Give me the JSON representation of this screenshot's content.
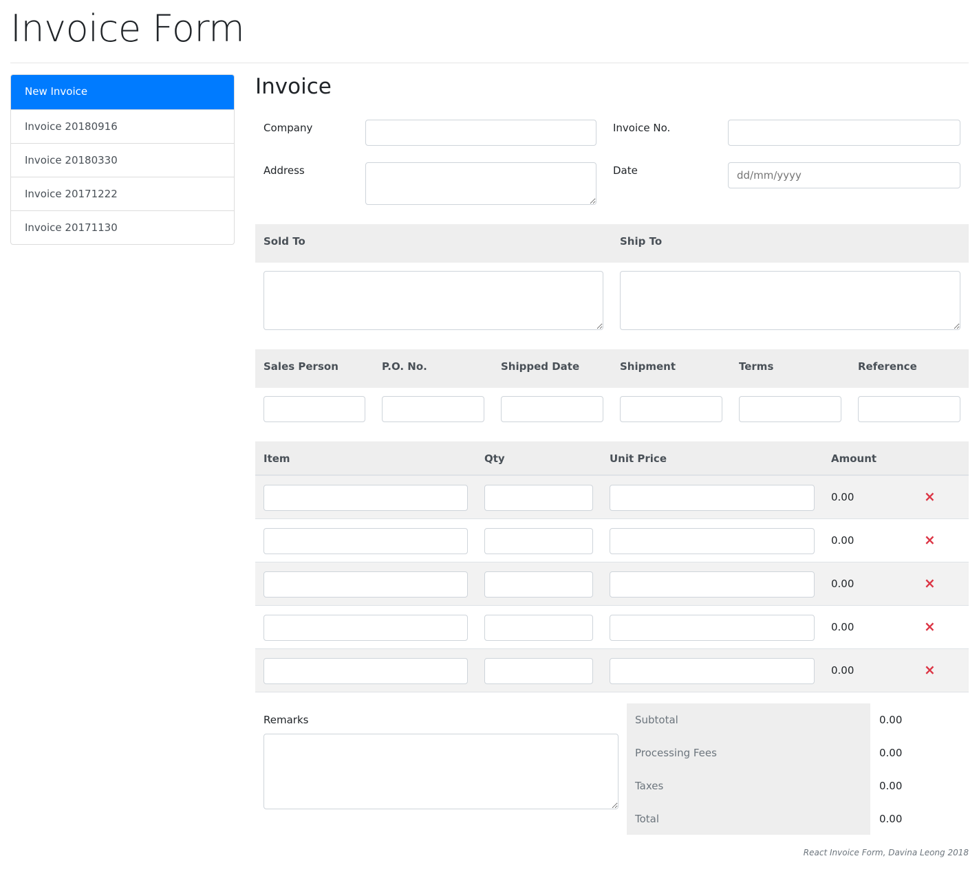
{
  "title": "Invoice Form",
  "sidebar": {
    "items": [
      {
        "label": "New Invoice"
      },
      {
        "label": "Invoice 20180916"
      },
      {
        "label": "Invoice 20180330"
      },
      {
        "label": "Invoice 20171222"
      },
      {
        "label": "Invoice 20171130"
      }
    ]
  },
  "form": {
    "heading": "Invoice",
    "company_label": "Company",
    "invoice_no_label": "Invoice No.",
    "address_label": "Address",
    "date_label": "Date",
    "date_placeholder": "dd/mm/yyyy"
  },
  "addresses": {
    "sold_to": "Sold To",
    "ship_to": "Ship To"
  },
  "details": {
    "headers": [
      "Sales Person",
      "P.O. No.",
      "Shipped Date",
      "Shipment",
      "Terms",
      "Reference"
    ]
  },
  "items": {
    "headers": {
      "item": "Item",
      "qty": "Qty",
      "unit_price": "Unit Price",
      "amount": "Amount"
    },
    "rows": [
      {
        "amount": "0.00"
      },
      {
        "amount": "0.00"
      },
      {
        "amount": "0.00"
      },
      {
        "amount": "0.00"
      },
      {
        "amount": "0.00"
      }
    ],
    "delete_icon": "×"
  },
  "remarks_label": "Remarks",
  "totals": {
    "subtotal_label": "Subtotal",
    "subtotal": "0.00",
    "fees_label": "Processing Fees",
    "fees": "0.00",
    "taxes_label": "Taxes",
    "taxes": "0.00",
    "total_label": "Total",
    "total": "0.00"
  },
  "footer": "React Invoice Form, Davina Leong 2018",
  "colors": {
    "accent": "#007bff",
    "danger": "#dc3545",
    "band": "#eeeeee"
  }
}
